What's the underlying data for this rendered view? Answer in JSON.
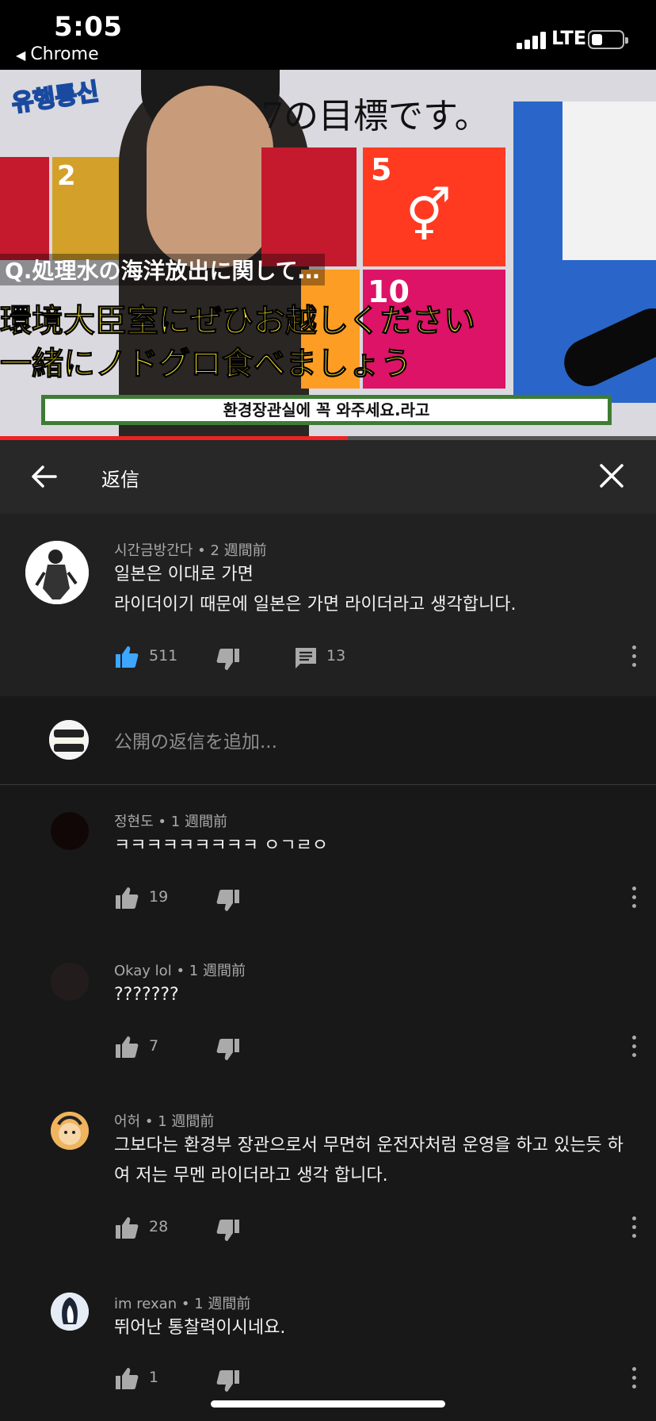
{
  "status_bar": {
    "time": "5:05",
    "back_app": "Chrome",
    "back_icon": "back-triangle-icon",
    "network": "LTE",
    "battery_level": 0.35
  },
  "video": {
    "logo_text": "유행통신",
    "headline_text": "7の目標です。",
    "sdg_tiles": [
      {
        "number": "",
        "color": "#c5192d"
      },
      {
        "number": "2",
        "color": "#d3a029"
      },
      {
        "number": "",
        "color": "#c5192d"
      },
      {
        "number": "5",
        "color": "#ff3a21"
      },
      {
        "number": "10",
        "color": "#dd1367"
      },
      {
        "number": "",
        "color": "#fd9d24"
      }
    ],
    "jp_caption_1": "Q.処理水の海洋放出に関して…",
    "jp_caption_2": "環境大臣室にぜひお越しください",
    "jp_caption_3": "一緒にノドグロ食べましょう",
    "subtitle": "환경장관실에 꼭 와주세요.라고",
    "progress": 0.53
  },
  "replies_header": {
    "title": "返信",
    "back_icon": "arrow-left-icon",
    "close_icon": "close-icon"
  },
  "parent_comment": {
    "author": "시간금방간다",
    "time": "2 週間前",
    "text_line_1": "일본은 이대로 가면",
    "text_line_2": "라이더이기 때문에 일본은 가면 라이더라고 생각합니다.",
    "likes": "511",
    "replies": "13",
    "liked": true,
    "accent_color": "#3ea6ff"
  },
  "add_reply": {
    "placeholder": "公開の返信を追加..."
  },
  "replies": [
    {
      "author": "정현도",
      "time": "1 週間前",
      "lines": [
        "ㅋㅋㅋㅋㅋㅋㅋㅋㅋ ㅇㄱㄹㅇ"
      ],
      "likes": "19"
    },
    {
      "author": "Okay lol",
      "time": "1 週間前",
      "lines": [
        "???????"
      ],
      "likes": "7"
    },
    {
      "author": "어허",
      "time": "1 週間前",
      "lines": [
        "그보다는 환경부 장관으로서 무면허 운전자처럼 운영을 하고 있는듯 하",
        "여 저는 무멘 라이더라고 생각 합니다."
      ],
      "likes": "28"
    },
    {
      "author": "im rexan",
      "time": "1 週間前",
      "lines": [
        "뛰어난 통찰력이시네요."
      ],
      "likes": "1"
    }
  ],
  "separator": "•"
}
